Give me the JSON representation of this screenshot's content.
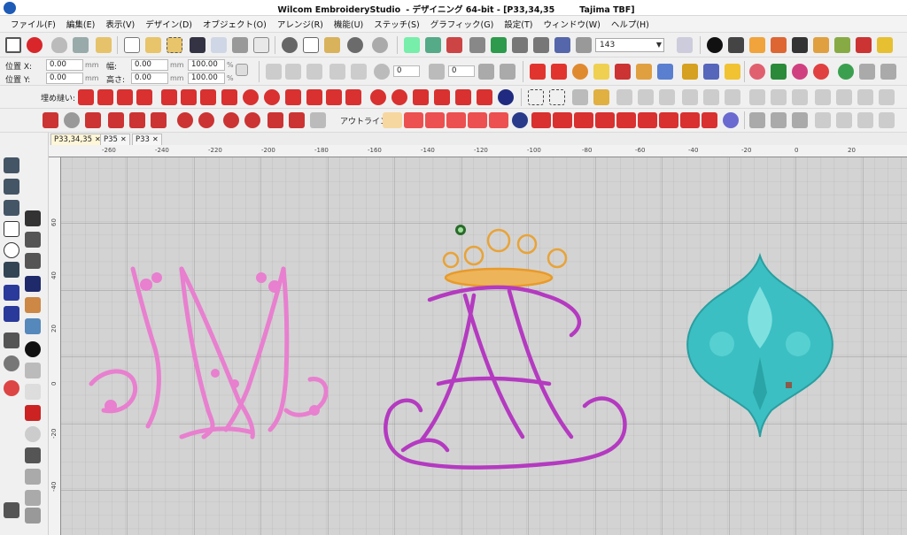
{
  "window": {
    "app_name": "Wilcom EmbroideryStudio",
    "mode_title": "- デザイニング 64-bit - [P33,34,35",
    "machine": "Tajima TBF]"
  },
  "menu": [
    "ファイル(F)",
    "編集(E)",
    "表示(V)",
    "デザイン(D)",
    "オブジェクト(O)",
    "アレンジ(R)",
    "機能(U)",
    "ステッチ(S)",
    "グラフィック(G)",
    "設定(T)",
    "ウィンドウ(W)",
    "ヘルプ(H)"
  ],
  "toolbar": {
    "zoom_value": "143"
  },
  "properties": {
    "pos_x_label": "位置 X:",
    "pos_y_label": "位置 Y:",
    "pos_x_value": "0.00",
    "pos_y_value": "0.00",
    "width_label": "幅:",
    "height_label": "高さ:",
    "width_value": "0.00",
    "height_value": "0.00",
    "scale_w_value": "100.00",
    "scale_h_value": "100.00",
    "unit_mm": "mm",
    "unit_pct": "%",
    "angle_value": "0",
    "slant_value": "0"
  },
  "fill_stitch_label": "埋め縫い:",
  "outline_label": "アウトライン:",
  "tabs": [
    {
      "label": "P33,34,35",
      "active": true
    },
    {
      "label": "P35",
      "active": false
    },
    {
      "label": "P33",
      "active": false
    }
  ],
  "ruler": {
    "h_labels": [
      "-260",
      "-240",
      "-220",
      "-200",
      "-180",
      "-160",
      "-140",
      "-120",
      "-100",
      "-80",
      "-60",
      "-40",
      "-20",
      "0",
      "20"
    ],
    "v_labels": [
      "60",
      "40",
      "20",
      "0",
      "-20",
      "-40"
    ]
  },
  "colors": {
    "m_monogram": "#e87fcf",
    "crown": "#e8a338",
    "a_monogram": "#b43ac0",
    "damask": "#3bbfc2",
    "grid_bg": "#d3d3d3",
    "grid_line": "#a9a9a9"
  }
}
